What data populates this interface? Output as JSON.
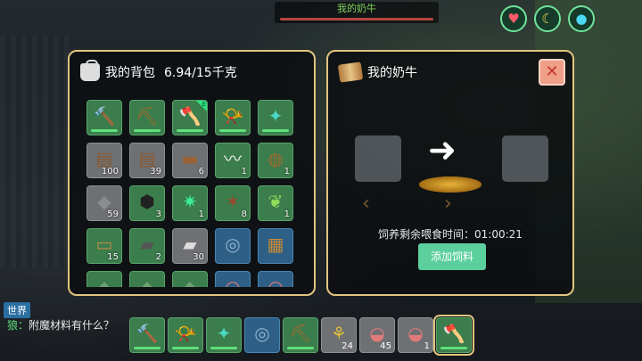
{
  "target": {
    "name": "我的奶牛"
  },
  "stats": {
    "health_icon": "heart-icon",
    "food_icon": "banana-icon",
    "water_icon": "droplet-icon"
  },
  "bag": {
    "title": "我的背包",
    "weight": "6.94/15千克",
    "slots": [
      {
        "icon": "hammer",
        "bg": "green",
        "qty": "",
        "dur": true,
        "tag": ""
      },
      {
        "icon": "pickaxe",
        "bg": "green",
        "qty": "",
        "dur": true,
        "tag": ""
      },
      {
        "icon": "club",
        "bg": "green",
        "qty": "",
        "dur": true,
        "tag": "E"
      },
      {
        "icon": "horn",
        "bg": "green",
        "qty": "",
        "dur": true,
        "tag": ""
      },
      {
        "icon": "staff",
        "bg": "green",
        "qty": "",
        "dur": true,
        "tag": ""
      },
      {
        "icon": "logs",
        "bg": "gray",
        "qty": "100",
        "dur": false,
        "tag": ""
      },
      {
        "icon": "logs",
        "bg": "gray",
        "qty": "39",
        "dur": false,
        "tag": ""
      },
      {
        "icon": "log",
        "bg": "gray",
        "qty": "6",
        "dur": false,
        "tag": ""
      },
      {
        "icon": "fiber",
        "bg": "green",
        "qty": "1",
        "dur": false,
        "tag": ""
      },
      {
        "icon": "stump",
        "bg": "green",
        "qty": "1",
        "dur": false,
        "tag": ""
      },
      {
        "icon": "stone",
        "bg": "gray",
        "qty": "59",
        "dur": false,
        "tag": ""
      },
      {
        "icon": "coal",
        "bg": "green",
        "qty": "3",
        "dur": false,
        "tag": ""
      },
      {
        "icon": "gem",
        "bg": "green",
        "qty": "1",
        "dur": false,
        "tag": ""
      },
      {
        "icon": "leather",
        "bg": "green",
        "qty": "8",
        "dur": false,
        "tag": ""
      },
      {
        "icon": "leaf",
        "bg": "green",
        "qty": "1",
        "dur": false,
        "tag": ""
      },
      {
        "icon": "plank",
        "bg": "green",
        "qty": "15",
        "dur": false,
        "tag": ""
      },
      {
        "icon": "ingot",
        "bg": "green",
        "qty": "2",
        "dur": false,
        "tag": ""
      },
      {
        "icon": "silver",
        "bg": "gray",
        "qty": "30",
        "dur": false,
        "tag": ""
      },
      {
        "icon": "disc",
        "bg": "blue",
        "qty": "",
        "dur": false,
        "tag": ""
      },
      {
        "icon": "book",
        "bg": "blue",
        "qty": "",
        "dur": false,
        "tag": ""
      },
      {
        "icon": "item",
        "bg": "green",
        "qty": "",
        "dur": false,
        "tag": ""
      },
      {
        "icon": "item",
        "bg": "green",
        "qty": "",
        "dur": false,
        "tag": ""
      },
      {
        "icon": "item",
        "bg": "green",
        "qty": "",
        "dur": false,
        "tag": ""
      },
      {
        "icon": "meat",
        "bg": "blue",
        "qty": "",
        "dur": false,
        "tag": ""
      },
      {
        "icon": "meat",
        "bg": "blue",
        "qty": "",
        "dur": false,
        "tag": ""
      }
    ]
  },
  "cow": {
    "title": "我的奶牛",
    "feed_time_label": "饲养剩余喂食时间：01:00:21",
    "add_feed_label": "添加饲料",
    "close_glyph": "✕"
  },
  "chat": {
    "channel": "世界",
    "speaker": "狼：",
    "message": "附魔材料有什么？"
  },
  "hotbar": [
    {
      "icon": "hammer",
      "bg": "green",
      "qty": "",
      "dur": true
    },
    {
      "icon": "horn",
      "bg": "green",
      "qty": "",
      "dur": true
    },
    {
      "icon": "staff",
      "bg": "green",
      "qty": "",
      "dur": true
    },
    {
      "icon": "disc",
      "bg": "blue",
      "qty": "",
      "dur": false
    },
    {
      "icon": "pickaxe",
      "bg": "green",
      "qty": "",
      "dur": true
    },
    {
      "icon": "wheat",
      "bg": "gray",
      "qty": "24",
      "dur": false
    },
    {
      "icon": "meat",
      "bg": "gray",
      "qty": "45",
      "dur": false
    },
    {
      "icon": "meat",
      "bg": "gray",
      "qty": "1",
      "dur": false
    },
    {
      "icon": "club",
      "bg": "green",
      "qty": "",
      "dur": true,
      "selected": true
    }
  ],
  "colors": {
    "panel_border": "#e2c47f",
    "slot_green": "#3b7d4c",
    "button_green": "#5bcf9e",
    "close_red": "#f0a089"
  }
}
